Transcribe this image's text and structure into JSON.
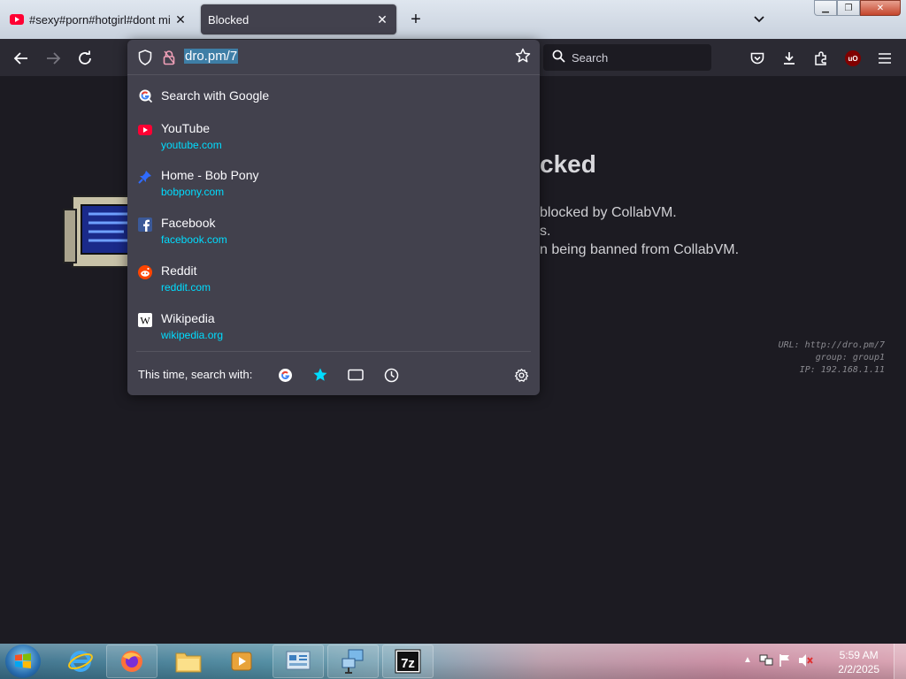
{
  "tabs": [
    {
      "title": "#sexy#porn#hotgirl#dont miss",
      "icon": "youtube-icon",
      "active": false
    },
    {
      "title": "Blocked",
      "active": true
    }
  ],
  "navbar": {
    "search_placeholder": "Search"
  },
  "url_popup": {
    "url": "dro.pm/7",
    "search_with_google": "Search with Google",
    "results": [
      {
        "title": "YouTube",
        "url": "youtube.com",
        "icon": "youtube-icon"
      },
      {
        "title": "Home - Bob Pony",
        "url": "bobpony.com",
        "icon": "pin-icon"
      },
      {
        "title": "Facebook",
        "url": "facebook.com",
        "icon": "facebook-icon"
      },
      {
        "title": "Reddit",
        "url": "reddit.com",
        "icon": "reddit-icon"
      },
      {
        "title": "Wikipedia",
        "url": "wikipedia.org",
        "icon": "wikipedia-icon"
      }
    ],
    "footer_label": "This time, search with:"
  },
  "page": {
    "heading_fragment": "cked",
    "lines": [
      "blocked by CollabVM.",
      "s.",
      "n being banned from CollabVM."
    ],
    "debug": {
      "url": "URL: http://dro.pm/7",
      "group": "group: group1",
      "ip": "IP: 192.168.1.11"
    }
  },
  "taskbar": {
    "time": "5:59 AM",
    "date": "2/2/2025"
  },
  "colors": {
    "accent_link": "#00ddff",
    "popup_bg": "#42414d",
    "toolbar_bg": "#2b2a33",
    "page_bg": "#1c1b22"
  }
}
